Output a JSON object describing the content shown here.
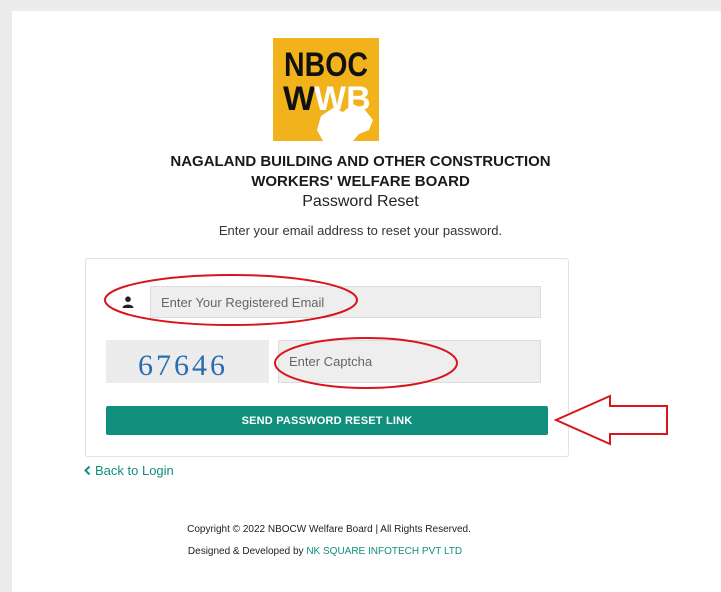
{
  "logo": {
    "line1": "NBOC",
    "line2_w": "W",
    "line2_wb": "WB",
    "accent": "#f2b21c"
  },
  "header": {
    "org_line1": "NAGALAND BUILDING AND OTHER CONSTRUCTION",
    "org_line2": "WORKERS' WELFARE BOARD",
    "subtitle": "Password Reset",
    "instruction": "Enter your email address to reset your password."
  },
  "form": {
    "email_placeholder": "Enter Your Registered Email",
    "email_icon": "user-icon",
    "captcha_text": "67646",
    "captcha_placeholder": "Enter Captcha",
    "submit_label": "SEND PASSWORD RESET LINK"
  },
  "nav": {
    "back_label": "Back to Login"
  },
  "footer": {
    "copyright": "Copyright © 2022 NBOCW Welfare Board | All Rights Reserved.",
    "designed_prefix": "Designed & Developed by ",
    "designed_link": "NK SQUARE INFOTECH PVT LTD"
  },
  "colors": {
    "brand": "#0f8f7c",
    "annotation": "#d8141c",
    "captcha_text": "#2a6db3"
  }
}
